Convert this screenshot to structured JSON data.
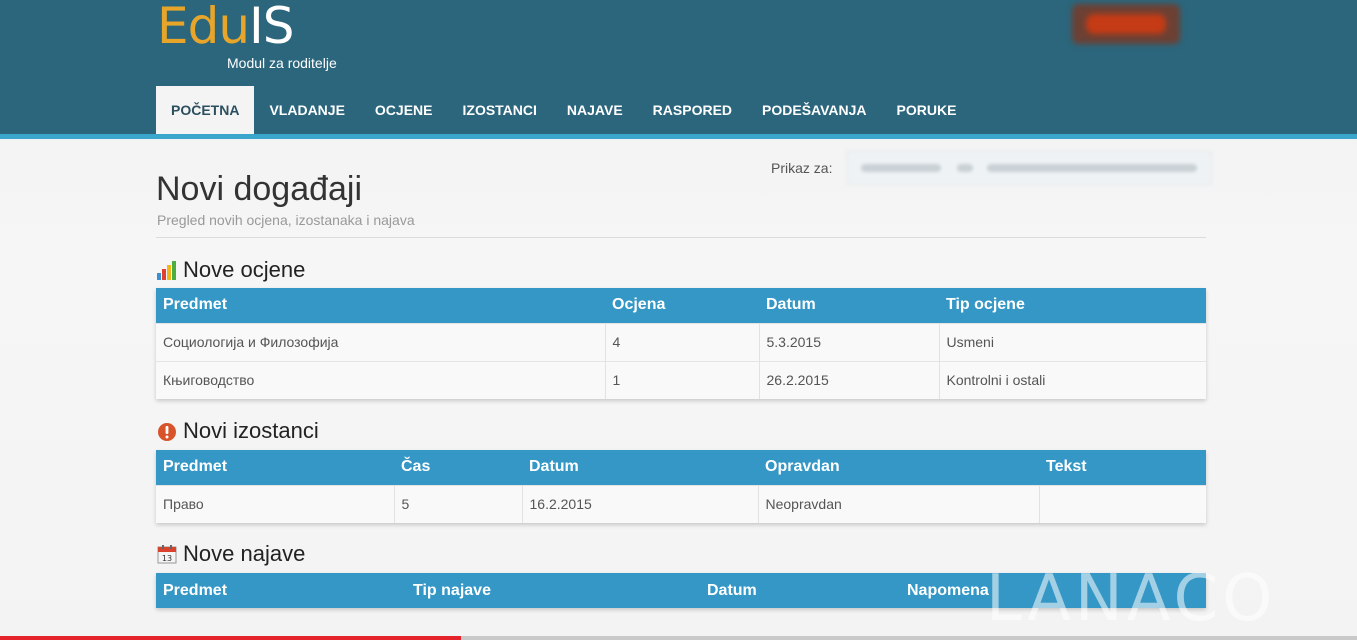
{
  "header": {
    "logo_edu": "Edu",
    "logo_is": "IS",
    "logo_subtitle": "Modul za roditelje"
  },
  "nav": {
    "items": [
      {
        "label": "POČETNA",
        "active": true
      },
      {
        "label": "VLADANJE"
      },
      {
        "label": "OCJENE"
      },
      {
        "label": "IZOSTANCI"
      },
      {
        "label": "NAJAVE"
      },
      {
        "label": "RASPORED"
      },
      {
        "label": "PODEŠAVANJA"
      },
      {
        "label": "PORUKE"
      }
    ]
  },
  "main": {
    "prikaz_label": "Prikaz za:",
    "title": "Novi događaji",
    "subtitle": "Pregled novih ocjena, izostanaka i najava"
  },
  "ocjene": {
    "title": "Nove ocjene",
    "icon": "bar-chart-icon",
    "headers": [
      "Predmet",
      "Ocjena",
      "Datum",
      "Tip ocjene"
    ],
    "rows": [
      [
        "Социологија и Филозофија",
        "4",
        "5.3.2015",
        "Usmeni"
      ],
      [
        "Књиговодство",
        "1",
        "26.2.2015",
        "Kontrolni i ostali"
      ]
    ]
  },
  "izostanci": {
    "title": "Novi izostanci",
    "icon": "warning-icon",
    "headers": [
      "Predmet",
      "Čas",
      "Datum",
      "Opravdan",
      "Tekst"
    ],
    "rows": [
      [
        "Право",
        "5",
        "16.2.2015",
        "Neopravdan",
        ""
      ]
    ]
  },
  "najave": {
    "title": "Nove najave",
    "icon": "calendar-icon",
    "headers": [
      "Predmet",
      "Tip najave",
      "Datum",
      "Napomena"
    ]
  },
  "overlay": {
    "watermark": "LANACO",
    "progress": 0.34
  },
  "colors": {
    "header_bg": "#2b667d",
    "accent_stripe": "#3aa6cc",
    "table_header": "#3497c6",
    "logo_orange": "#e7a52a"
  }
}
